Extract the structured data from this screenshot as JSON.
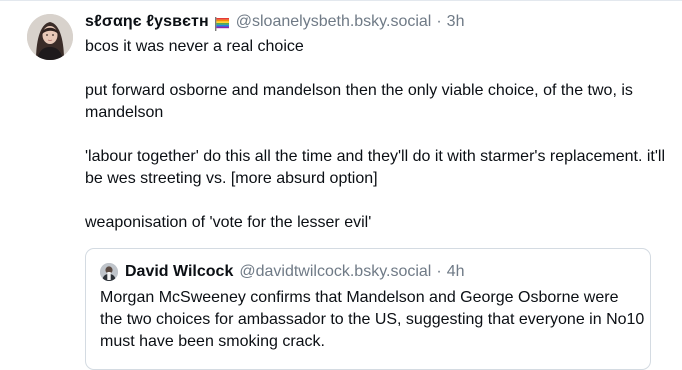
{
  "post": {
    "author": {
      "display_name": "ѕℓσαηє ℓуѕвєтн",
      "flag_icon": "rainbow-flag-icon",
      "handle": "@sloanelysbeth.bsky.social",
      "separator": "·",
      "time": "3h"
    },
    "paragraphs": [
      "bcos it was never a real choice",
      "put forward osborne and mandelson then the only viable choice, of the two, is mandelson",
      "'labour together' do this all the time and they'll do it with starmer's replacement. it'll be wes streeting vs. [more absurd option]",
      "weaponisation of 'vote for the lesser evil'"
    ],
    "quote": {
      "display_name": "David Wilcock",
      "handle": "@davidtwilcock.bsky.social",
      "separator": "·",
      "time": "4h",
      "text": "Morgan McSweeney confirms that Mandelson and George Osborne were the two choices for ambassador to the US, suggesting that everyone in No10 must have been smoking crack."
    }
  },
  "colors": {
    "text": "#0b0f14",
    "muted": "#6f7a86",
    "border": "#d4dbe2"
  }
}
